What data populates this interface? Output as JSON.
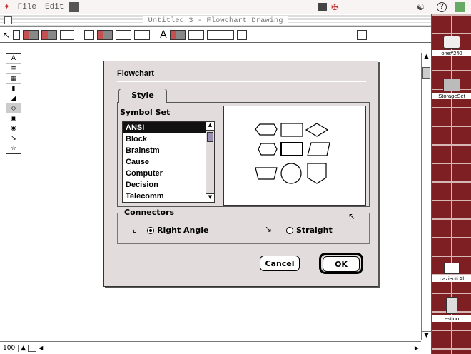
{
  "menubar": {
    "file": "File",
    "edit": "Edit"
  },
  "window": {
    "title": "Untitled 3 - Flowchart Drawing",
    "zoom": "100"
  },
  "dialog": {
    "title": "Flowchart",
    "tab": "Style",
    "symbol_set_label": "Symbol Set",
    "symbol_sets": [
      "ANSI",
      "Block",
      "Brainstm",
      "Cause",
      "Computer",
      "Decision",
      "Telecomm"
    ],
    "selected_symbol_set": "ANSI",
    "connectors_label": "Connectors",
    "connector_options": [
      {
        "label": "Right Angle",
        "selected": true
      },
      {
        "label": "Straight",
        "selected": false
      }
    ],
    "cancel_label": "Cancel",
    "ok_label": "OK"
  },
  "desktop": {
    "icons": [
      "one#240",
      "StorageSet",
      "pazienti Al",
      "estino"
    ]
  },
  "colors": {
    "brick": "#7e1f23",
    "mortar": "#d7b7b4",
    "dialog_bg": "#e2dcdc"
  }
}
